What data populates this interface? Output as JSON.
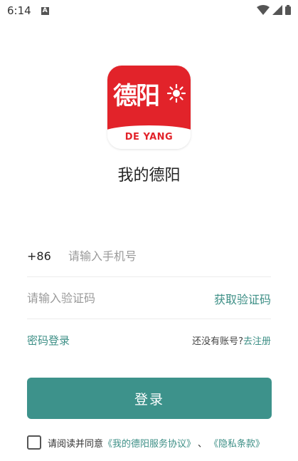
{
  "status_bar": {
    "time": "6:14",
    "notification_icon": "a-icon",
    "icons": [
      "wifi-icon",
      "signal-icon",
      "battery-icon"
    ]
  },
  "logo": {
    "glyph_text": "德阳",
    "caption": "DE YANG"
  },
  "app_name": "我的德阳",
  "phone": {
    "country_code": "+86",
    "placeholder": "请输入手机号",
    "value": ""
  },
  "code": {
    "placeholder": "请输入验证码",
    "value": "",
    "get_code_label": "获取验证码"
  },
  "links": {
    "password_login": "密码登录",
    "no_account_text": "还没有账号?",
    "register_label": "去注册"
  },
  "login_button": "登录",
  "agreement": {
    "checked": false,
    "prefix": "请阅读并同意",
    "service_terms": "《我的德阳服务协议》",
    "separator": "、",
    "privacy_terms": "《隐私条款》"
  },
  "colors": {
    "accent": "#3d928b",
    "link": "#3d8f86",
    "brand_red": "#e2232a"
  }
}
